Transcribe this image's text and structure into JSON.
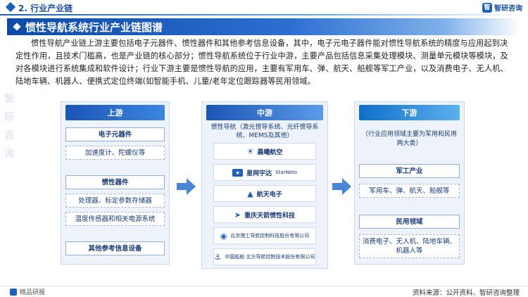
{
  "header": {
    "section_title": "2. 行业产业链",
    "logo_text": "智研咨询"
  },
  "title": "惯性导航系统行业产业链图谱",
  "description": "惯性导航产业链上游主要包括电子元器件、惯性器件和其他参考信息设备，其中，电子元电子器件能对惯性导航系统的精度与应用起到决定性作用，且技术门槛高，也是产业链的核心部分；惯性导航系统位于行业中游，主要产品包括信息采集处理模块、测量单元模块等模块，及对各模块进行系统集成和软件设计；行业下游主要是惯性导航的应用，主要有军用车、弹、航天、船舰等军工产业，以及消费电子、无人机、陆地车辆、机器人、便携式定位终端(如智能手机、儿童/老年定位跟踪器等民用领域。",
  "upstream": {
    "label": "上游",
    "group1_title": "电子元器件",
    "group1_item": "加速度计、陀螺仪等",
    "group2_title": "惯性器件",
    "group2_items": [
      "处理器、标定参数存储器",
      "温度传感器和相关电源系统"
    ],
    "group3_title": "其他参考信息设备"
  },
  "midstream": {
    "label": "中游",
    "note": "惯性导航（激光惯导系统、光纤惯导系统、MEMS及其他）",
    "companies": [
      {
        "name": "晨曦航空",
        "icon": "morning-sun-icon"
      },
      {
        "name": "星网宇达",
        "sub": "StarNeto",
        "icon": "star-icon"
      },
      {
        "name": "航天电子",
        "icon": "aerospace-icon"
      },
      {
        "name": "重庆天箭惯性科技",
        "icon": "arrow-icon"
      },
      {
        "name": "北京理工导航控制科技股份有限公司",
        "icon": "bit-nav-icon"
      },
      {
        "name": "中国船舶 北方导航控制技术股份有限公司",
        "icon": "north-nav-icon"
      }
    ]
  },
  "downstream": {
    "label": "下游",
    "note": "（行业应用领域主要为军用和民用两大类）",
    "military_title": "军工产业",
    "military_item": "军用车、弹、航天、船舰等",
    "civil_title": "民用领域",
    "civil_item": "消费电子、无人机、陆地车辆、机器人等"
  },
  "footer": {
    "left_label": "精品研报",
    "source": "资料来源：公开资料、智研咨询整理"
  },
  "watermark": [
    "智",
    "研",
    "咨",
    "询"
  ],
  "colors": {
    "primary": "#1f5fb8",
    "title_bar": "#0f4aa8",
    "panel_bg": "#eef3fb",
    "text_dark": "#1a3c78"
  }
}
